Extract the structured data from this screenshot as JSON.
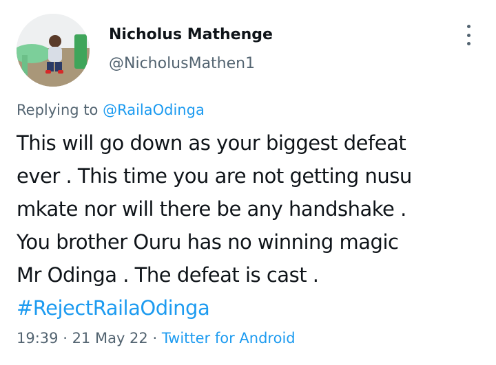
{
  "author": {
    "display_name": "Nicholus Mathenge",
    "handle": "@NicholusMathen1"
  },
  "reply": {
    "prefix": "Replying to ",
    "mention": "@RailaOdinga"
  },
  "tweet": {
    "lines": [
      "This will go down as your biggest defeat",
      "ever . This time you are not getting nusu",
      "mkate nor will there be any handshake .",
      "You brother Ouru has no winning magic",
      "Mr Odinga . The defeat is cast ."
    ],
    "hashtag": "#RejectRailaOdinga"
  },
  "meta": {
    "time": "19:39",
    "separator": " · ",
    "date": "21 May 22",
    "source": "Twitter for Android"
  },
  "icons": {
    "more": "more-vertical-icon"
  },
  "colors": {
    "text": "#0f1419",
    "secondary": "#536471",
    "link": "#1d9bf0"
  }
}
